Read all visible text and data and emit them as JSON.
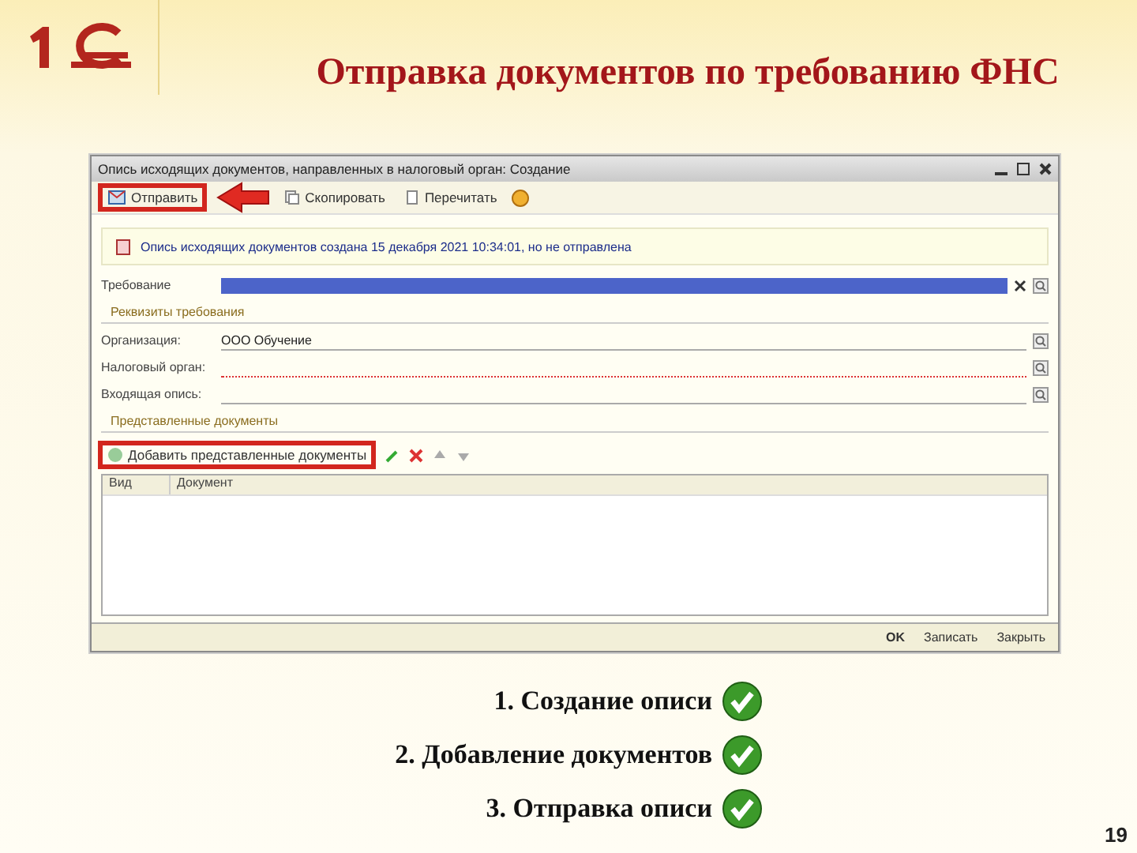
{
  "slide": {
    "title": "Отправка документов по требованию ФНС",
    "page_number": "19"
  },
  "window": {
    "title": "Опись исходящих документов, направленных в налоговый орган: Создание",
    "toolbar": [
      {
        "label": "Отправить",
        "highlighted": true
      },
      {
        "label": "Скопировать",
        "highlighted": false
      },
      {
        "label": "Перечитать",
        "highlighted": false
      }
    ],
    "info": "Опись исходящих документов создана 15 декабря 2021 10:34:01, но не отправлена",
    "requirement": {
      "label": "Требование"
    },
    "requisites_section": "Реквизиты требования",
    "fields": [
      {
        "label": "Организация:",
        "value": "ООО Обучение",
        "required": false
      },
      {
        "label": "Налоговый орган:",
        "required": true
      },
      {
        "label": "Входящая опись:",
        "required": false
      }
    ],
    "documents_section": "Представленные документы",
    "add_button": {
      "label": "Добавить представленные документы",
      "highlighted": true
    },
    "table": {
      "columns": [
        "Вид",
        "Документ"
      ]
    },
    "footer_buttons": [
      "OK",
      "Записать",
      "Закрыть"
    ]
  },
  "steps": [
    {
      "label": "1. Создание описи",
      "done": true
    },
    {
      "label": "2. Добавление документов",
      "done": true
    },
    {
      "label": "3. Отправка описи",
      "done": true
    }
  ]
}
